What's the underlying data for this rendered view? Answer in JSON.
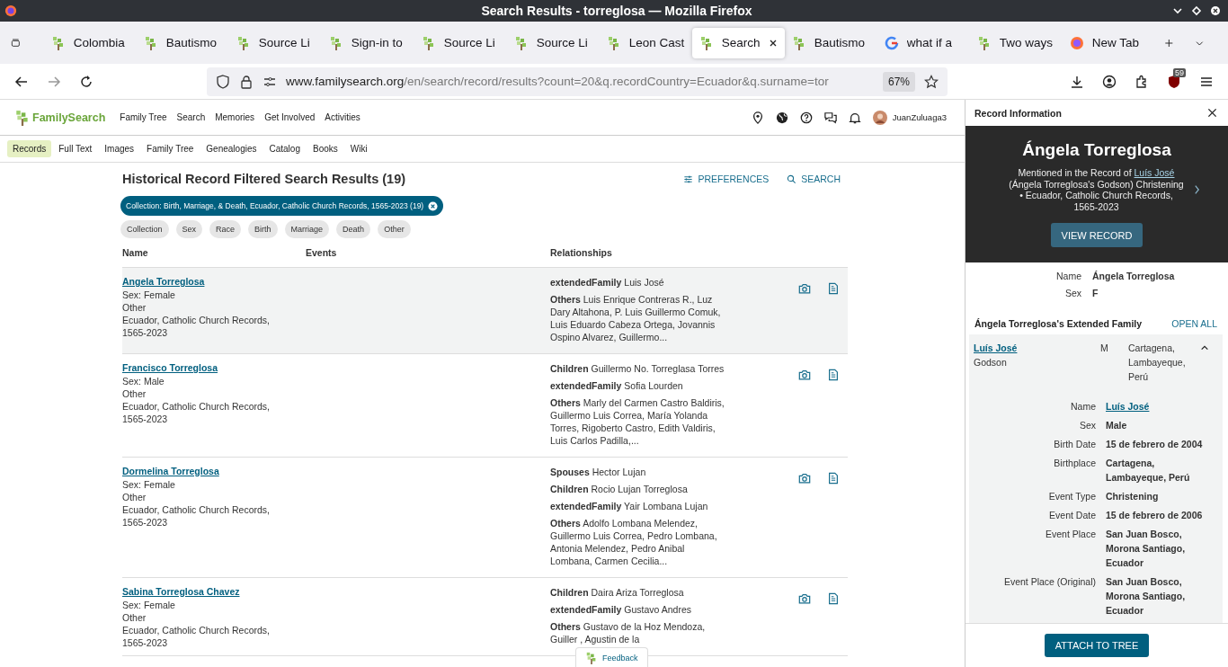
{
  "window": {
    "title": "Search Results - torreglosa — Mozilla Firefox"
  },
  "tabs": [
    {
      "label": "Colombia",
      "kind": "tree",
      "selected": false
    },
    {
      "label": "Bautismo",
      "kind": "tree",
      "selected": false
    },
    {
      "label": "Source Li",
      "kind": "tree",
      "selected": false
    },
    {
      "label": "Sign-in to",
      "kind": "tree",
      "selected": false
    },
    {
      "label": "Source Li",
      "kind": "tree",
      "selected": false
    },
    {
      "label": "Source Li",
      "kind": "tree",
      "selected": false
    },
    {
      "label": "Leon Cast",
      "kind": "tree",
      "selected": false
    },
    {
      "label": "Search",
      "kind": "tree",
      "selected": true
    },
    {
      "label": "Bautismo",
      "kind": "tree",
      "selected": false
    },
    {
      "label": "what if a",
      "kind": "google",
      "selected": false
    },
    {
      "label": "Two ways",
      "kind": "tree",
      "selected": false
    },
    {
      "label": "New Tab",
      "kind": "firefox",
      "selected": false
    }
  ],
  "toolbar": {
    "url_host": "www.familysearch.org",
    "url_path": "/en/search/record/results?count=20&q.recordCountry=Ecuador&q.surname=tor",
    "zoom": "67%",
    "badge": "59"
  },
  "site": {
    "logo": "FamilySearch",
    "nav": [
      "Family Tree",
      "Search",
      "Memories",
      "Get Involved",
      "Activities"
    ],
    "user": "JuanZuluaga3",
    "subnav": [
      {
        "label": "Records",
        "selected": true
      },
      {
        "label": "Full Text",
        "selected": false
      },
      {
        "label": "Images",
        "selected": false
      },
      {
        "label": "Family Tree",
        "selected": false
      },
      {
        "label": "Genealogies",
        "selected": false
      },
      {
        "label": "Catalog",
        "selected": false
      },
      {
        "label": "Books",
        "selected": false
      },
      {
        "label": "Wiki",
        "selected": false
      }
    ]
  },
  "results": {
    "heading": "Historical Record Filtered Search Results (19)",
    "actions": [
      {
        "label": "PREFERENCES",
        "kind": "sliders"
      },
      {
        "label": "SEARCH",
        "kind": "search"
      }
    ],
    "active_filter": "Collection: Birth, Marriage, & Death, Ecuador, Catholic Church Records, 1565-2023 (19)",
    "filters": [
      "Collection",
      "Sex",
      "Race",
      "Birth",
      "Marriage",
      "Death",
      "Other"
    ],
    "columns": [
      "Name",
      "Events",
      "Relationships"
    ],
    "rows": [
      {
        "name": "Angela Torreglosa",
        "selected": true,
        "details": [
          "Sex: Female",
          "Other",
          "Ecuador, Catholic Church Records, 1565-2023"
        ],
        "relationships": [
          {
            "label": "extendedFamily",
            "names": "Luis José"
          },
          {
            "label": "Others",
            "names": "Luis Enrique Contreras R., Luz Dary Altahona, P. Luis Guillermo Comuk, Luis Eduardo Cabeza Ortega, Jovannis Ospino Alvarez, Guillermo..."
          }
        ]
      },
      {
        "name": "Francisco Torreglosa",
        "selected": false,
        "details": [
          "Sex: Male",
          "Other",
          "Ecuador, Catholic Church Records, 1565-2023"
        ],
        "relationships": [
          {
            "label": "Children",
            "names": "Guillermo No. Torreglasa Torres"
          },
          {
            "label": "extendedFamily",
            "names": "Sofia Lourden"
          },
          {
            "label": "Others",
            "names": "Marly del Carmen Castro Baldiris, Guillermo Luis Correa, María Yolanda Torres, Rigoberto Castro, Edith Valdiris, Luis Carlos Padilla,..."
          }
        ]
      },
      {
        "name": "Dormelina Torreglosa",
        "selected": false,
        "details": [
          "Sex: Female",
          "Other",
          "Ecuador, Catholic Church Records, 1565-2023"
        ],
        "relationships": [
          {
            "label": "Spouses",
            "names": "Hector Lujan"
          },
          {
            "label": "Children",
            "names": "Rocio Lujan Torreglosa"
          },
          {
            "label": "extendedFamily",
            "names": "Yair Lombana Lujan"
          },
          {
            "label": "Others",
            "names": "Adolfo Lombana Melendez, Guillermo Luis Correa, Pedro Lombana, Antonia Melendez, Pedro Anibal Lombana, Carmen Cecilia..."
          }
        ]
      },
      {
        "name": "Sabina Torreglosa Chavez",
        "selected": false,
        "details": [
          "Sex: Female",
          "Other",
          "Ecuador, Catholic Church Records, 1565-2023"
        ],
        "relationships": [
          {
            "label": "Children",
            "names": "Daira Ariza Torreglosa"
          },
          {
            "label": "extendedFamily",
            "names": "Gustavo Andres"
          },
          {
            "label": "Others",
            "names": "Gustavo de la Hoz Mendoza, Guiller , Agustin de la"
          }
        ]
      }
    ]
  },
  "feedback": "Feedback",
  "panel": {
    "title": "Record Information",
    "person": "Ángela Torreglosa",
    "mention_prefix": "Mentioned in the Record of",
    "mention_link": "Luís José",
    "mention_suffix": "(Ángela Torreglosa's Godson) Christening • Ecuador, Catholic Church Records, 1565-2023",
    "view_button": "VIEW RECORD",
    "facts": [
      {
        "label": "Name",
        "value": "Ángela Torreglosa"
      },
      {
        "label": "Sex",
        "value": "F"
      }
    ],
    "family_heading": "Ángela Torreglosa's Extended Family",
    "open_all": "OPEN ALL",
    "members": [
      {
        "name": "Luís José",
        "relation": "Godson",
        "sex": "M",
        "place": "Cartagena, Lambayeque, Perú",
        "expanded": true,
        "details": [
          {
            "label": "Name",
            "value": "Luís José",
            "kind": "link"
          },
          {
            "label": "Sex",
            "value": "Male",
            "kind": "text"
          },
          {
            "label": "Birth Date",
            "value": "15 de febrero de 2004",
            "kind": "text"
          },
          {
            "label": "Birthplace",
            "value": "Cartagena, Lambayeque, Perú",
            "kind": "text"
          },
          {
            "label": "Event Type",
            "value": "Christening",
            "kind": "text"
          },
          {
            "label": "Event Date",
            "value": "15 de febrero de 2006",
            "kind": "text"
          },
          {
            "label": "Event Place",
            "value": "San Juan Bosco, Morona Santiago, Ecuador",
            "kind": "text"
          },
          {
            "label": "Event Place (Original)",
            "value": "San Juan Bosco, Morona Santiago, Ecuador",
            "kind": "text"
          }
        ]
      }
    ],
    "attach_button": "ATTACH TO TREE"
  }
}
